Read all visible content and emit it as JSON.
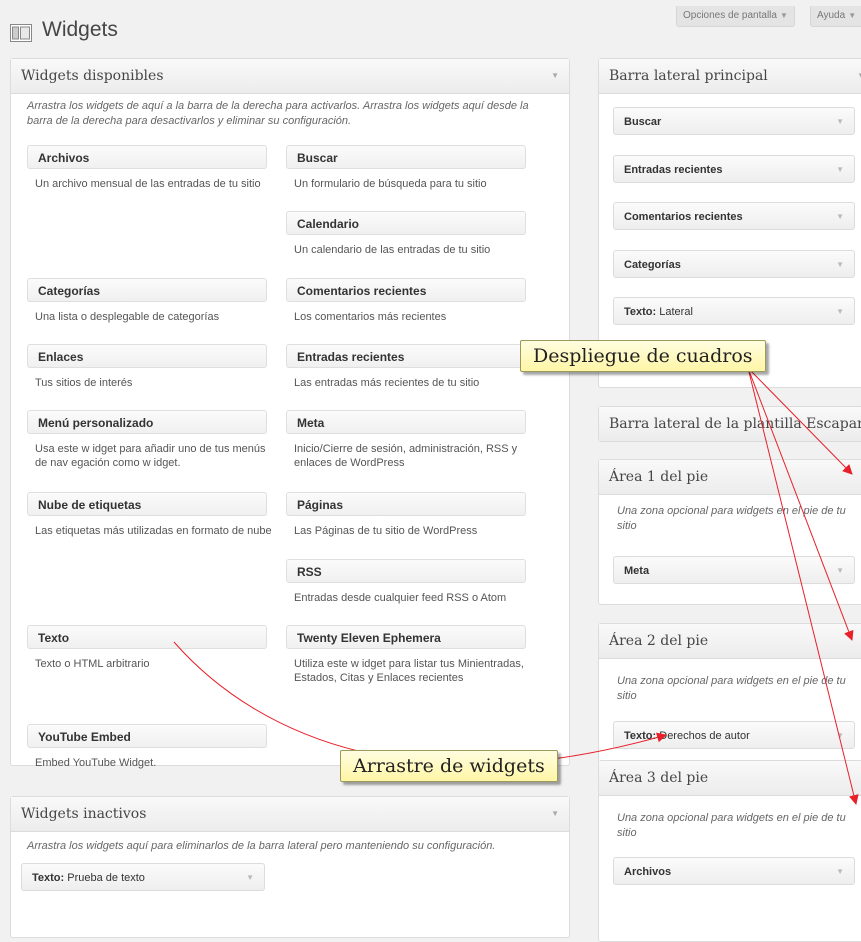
{
  "header": {
    "title": "Widgets",
    "screen_options": "Opciones de pantalla",
    "help": "Ayuda"
  },
  "available": {
    "title": "Widgets disponibles",
    "description": "Arrastra los widgets de aquí a la barra de la derecha para activarlos. Arrastra los widgets aquí desde la barra de la derecha para desactivarlos y eliminar su configuración.",
    "widgets": [
      {
        "name": "Archivos",
        "desc": "Un archivo mensual de las entradas de tu sitio"
      },
      {
        "name": "Buscar",
        "desc": "Un formulario de búsqueda para tu sitio"
      },
      {
        "name": "Calendario",
        "desc": "Un calendario de las entradas de tu sitio"
      },
      {
        "name": "Categorías",
        "desc": "Una lista o desplegable de categorías"
      },
      {
        "name": "Comentarios recientes",
        "desc": "Los comentarios más recientes"
      },
      {
        "name": "Enlaces",
        "desc": "Tus sitios de interés"
      },
      {
        "name": "Entradas recientes",
        "desc": "Las entradas más recientes de tu sitio"
      },
      {
        "name": "Menú personalizado",
        "desc": "Usa este w idget para añadir uno de tus menús de nav egación como w idget."
      },
      {
        "name": "Meta",
        "desc": "Inicio/Cierre de sesión, administración, RSS y enlaces de WordPress"
      },
      {
        "name": "Nube de etiquetas",
        "desc": "Las etiquetas más utilizadas en formato de nube"
      },
      {
        "name": "Páginas",
        "desc": "Las Páginas de tu sitio de WordPress"
      },
      {
        "name": "RSS",
        "desc": "Entradas desde cualquier feed RSS o Atom"
      },
      {
        "name": "Texto",
        "desc": "Texto o HTML arbitrario"
      },
      {
        "name": "Twenty Eleven Ephemera",
        "desc": "Utiliza este w idget para listar tus Minientradas, Estados, Citas y Enlaces recientes"
      },
      {
        "name": "YouTube Embed",
        "desc": "Embed YouTube Widget."
      }
    ]
  },
  "inactive": {
    "title": "Widgets inactivos",
    "description": "Arrastra los widgets aquí para eliminarlos de la barra lateral pero manteniendo su configuración.",
    "widget_label": "Texto:",
    "widget_value": "Prueba de texto"
  },
  "sidebars": {
    "main": {
      "title": "Barra lateral principal",
      "widgets": [
        "Buscar",
        "Entradas recientes",
        "Comentarios recientes",
        "Categorías"
      ],
      "text_label": "Texto:",
      "text_value": "Lateral"
    },
    "showcase": {
      "title": "Barra lateral de la plantilla Escapara"
    },
    "footer1": {
      "title": "Área 1 del pie",
      "description": "Una zona opcional para widgets en el pie de tu sitio",
      "widget": "Meta"
    },
    "footer2": {
      "title": "Área 2 del pie",
      "description": "Una zona opcional para widgets en el pie de tu sitio",
      "widget_label": "Texto:",
      "widget_value": "Derechos de autor"
    },
    "footer3": {
      "title": "Área 3 del pie",
      "description": "Una zona opcional para widgets en el pie de tu sitio",
      "widget": "Archivos"
    }
  },
  "annotations": {
    "expand": "Despliegue de cuadros",
    "drag": "Arrastre de widgets",
    "arrow_color": "#e8202a"
  }
}
